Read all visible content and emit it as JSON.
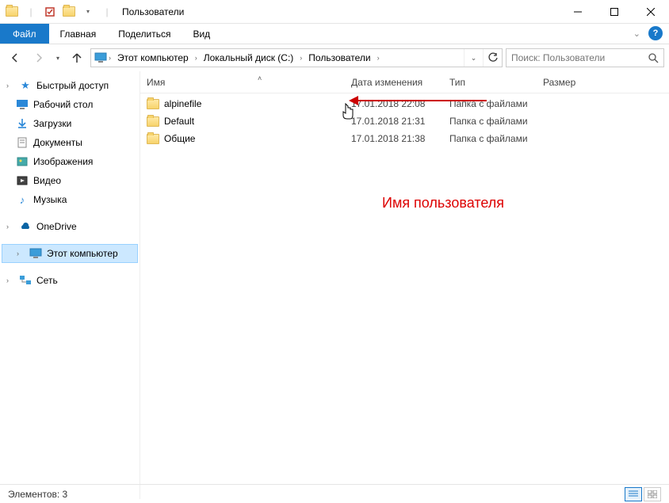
{
  "window": {
    "title": "Пользователи"
  },
  "ribbon": {
    "file": "Файл",
    "tabs": [
      "Главная",
      "Поделиться",
      "Вид"
    ]
  },
  "breadcrumbs": [
    "Этот компьютер",
    "Локальный диск (C:)",
    "Пользователи"
  ],
  "search": {
    "placeholder": "Поиск: Пользователи"
  },
  "columns": {
    "name": "Имя",
    "date": "Дата изменения",
    "type": "Тип",
    "size": "Размер"
  },
  "rows": [
    {
      "name": "alpinefile",
      "date": "17.01.2018 22:08",
      "type": "Папка с файлами"
    },
    {
      "name": "Default",
      "date": "17.01.2018 21:31",
      "type": "Папка с файлами"
    },
    {
      "name": "Общие",
      "date": "17.01.2018 21:38",
      "type": "Папка с файлами"
    }
  ],
  "sidebar": {
    "quick": "Быстрый доступ",
    "quick_items": [
      {
        "label": "Рабочий стол",
        "icon": "desktop"
      },
      {
        "label": "Загрузки",
        "icon": "downloads"
      },
      {
        "label": "Документы",
        "icon": "documents"
      },
      {
        "label": "Изображения",
        "icon": "pictures"
      },
      {
        "label": "Видео",
        "icon": "videos"
      },
      {
        "label": "Музыка",
        "icon": "music"
      }
    ],
    "onedrive": "OneDrive",
    "thispc": "Этот компьютер",
    "network": "Сеть"
  },
  "annotation": "Имя пользователя",
  "status": {
    "text": "Элементов: 3"
  }
}
